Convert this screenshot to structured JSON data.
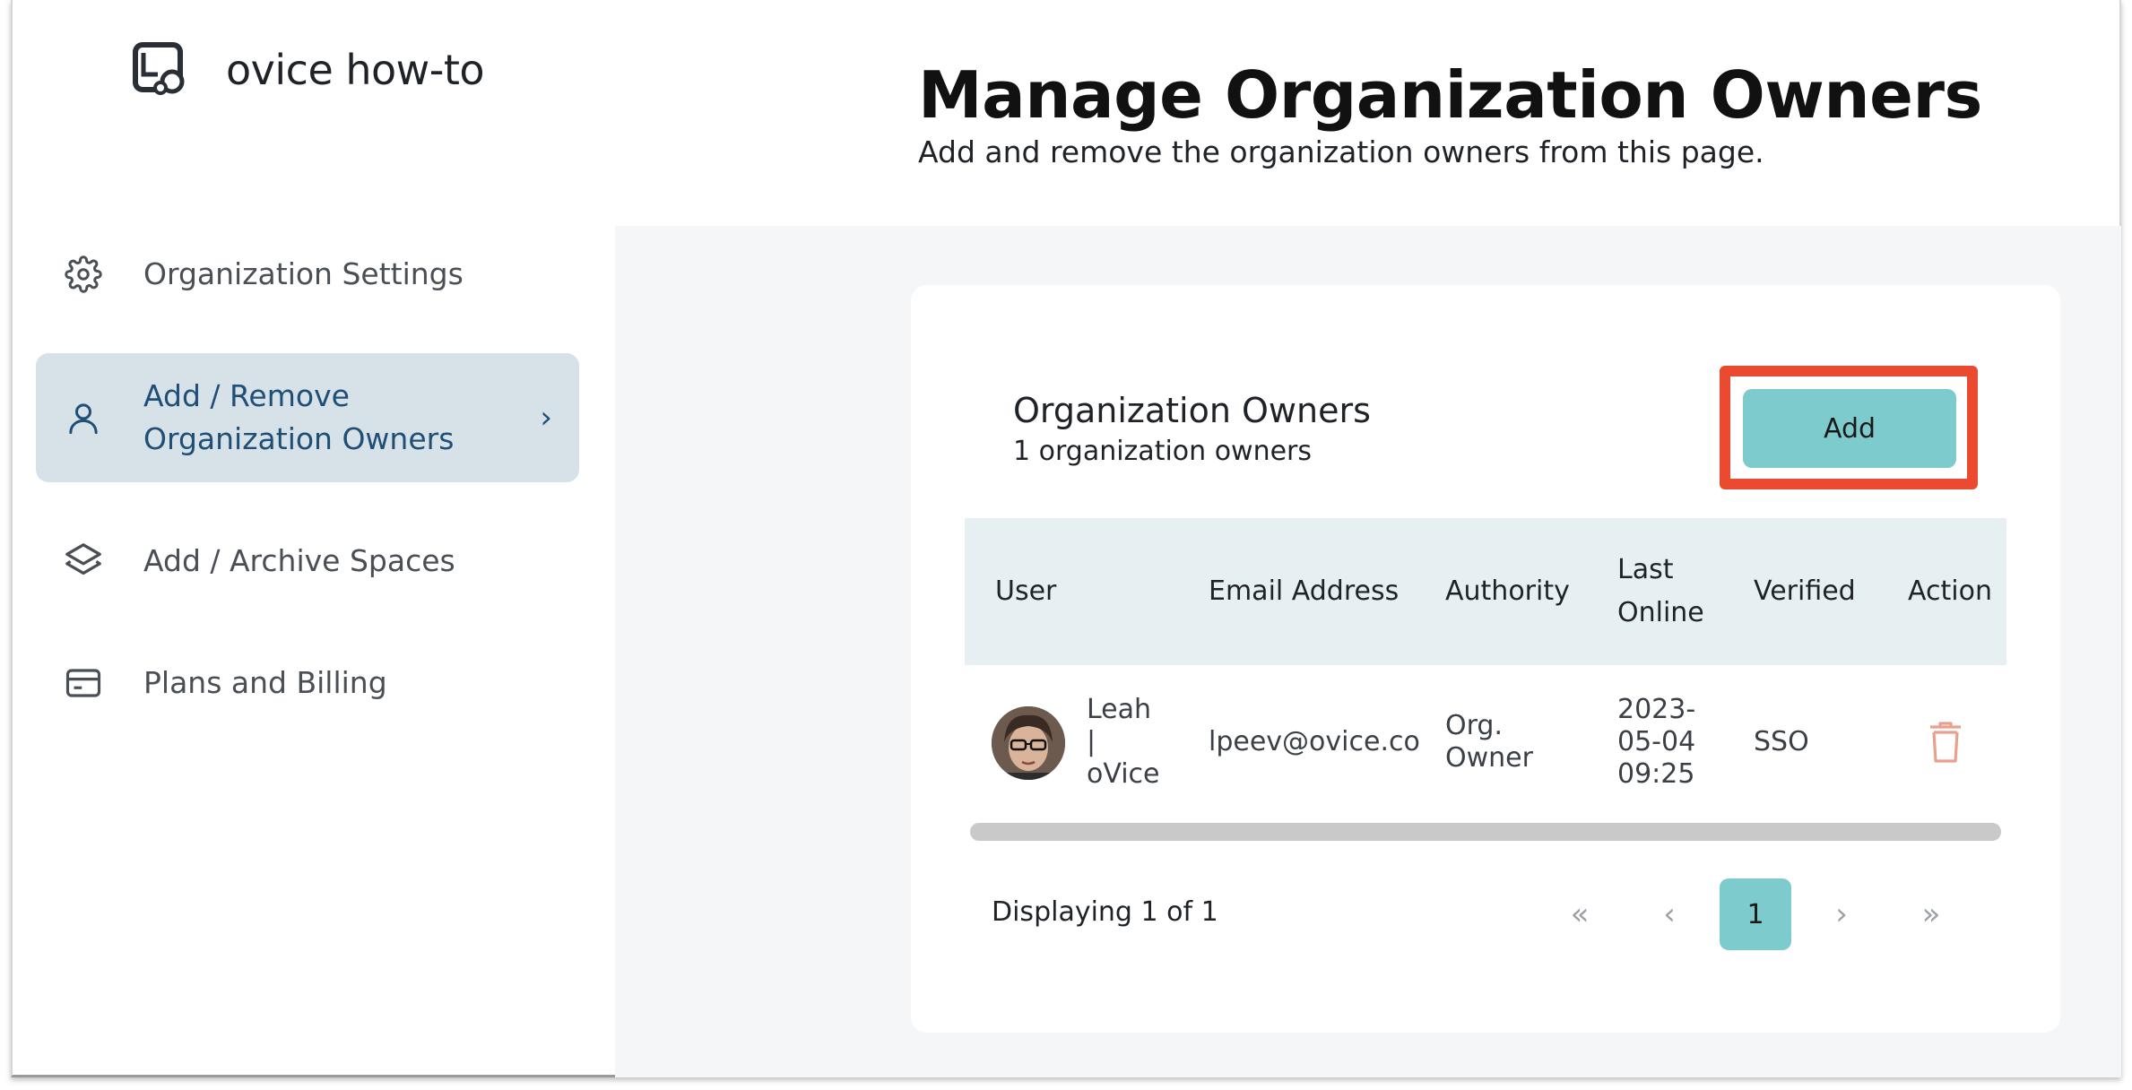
{
  "brand": {
    "name": "ovice how-to",
    "icon": "ovice-logo-icon"
  },
  "sidebar": {
    "items": [
      {
        "label": "Organization Settings",
        "icon": "gear-icon"
      },
      {
        "label_line1": "Add / Remove",
        "label_line2": "Organization Owners",
        "icon": "user-icon",
        "active": true,
        "chevron": "›"
      },
      {
        "label": "Add / Archive Spaces",
        "icon": "layers-icon"
      },
      {
        "label": "Plans and Billing",
        "icon": "credit-card-icon"
      }
    ]
  },
  "header": {
    "title": "Manage Organization Owners",
    "subtitle": "Add and remove the organization owners from this page."
  },
  "section": {
    "title": "Organization Owners",
    "count_text": "1 organization owners",
    "add_label": "Add"
  },
  "table": {
    "columns": [
      "User",
      "Email Address",
      "Authority",
      "Last",
      "Online",
      "Verified",
      "Action"
    ],
    "rows": [
      {
        "user_line1": "Leah",
        "user_line2": "|",
        "user_line3": "oVice",
        "email": "lpeev@ovice.co",
        "authority_line1": "Org.",
        "authority_line2": "Owner",
        "last_online_line1": "2023-",
        "last_online_line2": "05-04",
        "last_online_line3": "09:25",
        "verified": "SSO",
        "action_icon": "trash-icon"
      }
    ]
  },
  "pagination": {
    "display_text": "Displaying 1 of 1",
    "first": "«",
    "prev": "‹",
    "current": "1",
    "next": "›",
    "last": "»"
  },
  "colors": {
    "accent": "#7ecbcd",
    "highlight": "#ea4a2f",
    "active_nav_bg": "#d6e1e8",
    "active_nav_text": "#1f4f77",
    "table_header_bg": "#e6f0f2",
    "trash": "#e9a08d"
  }
}
